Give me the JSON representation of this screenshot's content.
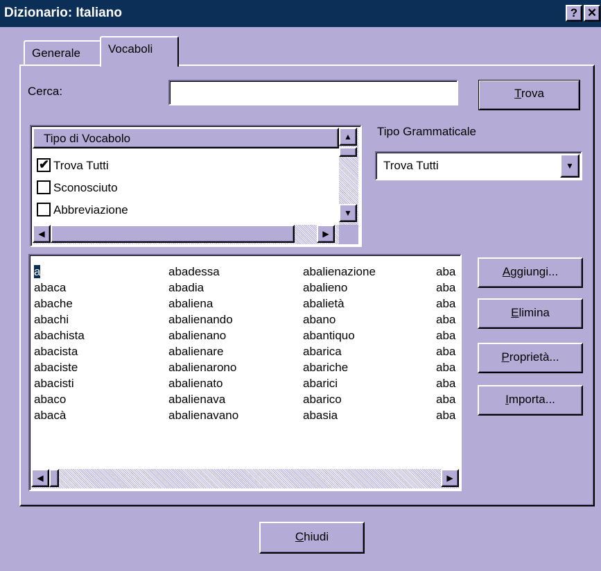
{
  "window": {
    "title": "Dizionario: Italiano",
    "help_label": "?",
    "close_label": "✕"
  },
  "tabs": [
    {
      "label": "Generale"
    },
    {
      "label": "Vocaboli"
    }
  ],
  "search": {
    "label": "Cerca:",
    "value": "",
    "button_label": "Trova",
    "button_mnemonic": "T",
    "button_rest": "rova"
  },
  "tipo_vocabolo": {
    "header": "Tipo di Vocabolo",
    "items": [
      {
        "label": "Trova Tutti",
        "checked": true
      },
      {
        "label": "Sconosciuto",
        "checked": false
      },
      {
        "label": "Abbreviazione",
        "checked": false
      }
    ]
  },
  "tipo_grammaticale": {
    "label": "Tipo Grammaticale",
    "selected": "Trova Tutti"
  },
  "words": {
    "columns": [
      [
        "a",
        "abaca",
        "abache",
        "abachi",
        "abachista",
        "abacista",
        "abaciste",
        "abacisti",
        "abaco",
        "abacà"
      ],
      [
        "abadessa",
        "abadia",
        "abaliena",
        "abalienando",
        "abalienano",
        "abalienare",
        "abalienarono",
        "abalienato",
        "abalienava",
        "abalienavano"
      ],
      [
        "abalienazione",
        "abalieno",
        "abalietà",
        "abano",
        "abantiquo",
        "abarica",
        "abariche",
        "abarici",
        "abarico",
        "abasia"
      ],
      [
        "aba",
        "aba",
        "aba",
        "aba",
        "aba",
        "aba",
        "aba",
        "aba",
        "aba",
        "aba"
      ]
    ],
    "selected": "a"
  },
  "buttons": {
    "aggiungi": {
      "mn": "A",
      "rest": "ggiungi..."
    },
    "elimina": {
      "mn": "E",
      "rest": "limina"
    },
    "proprieta": {
      "mn": "P",
      "rest": "roprietà..."
    },
    "importa": {
      "mn": "I",
      "rest": "mporta..."
    },
    "chiudi": {
      "mn": "C",
      "rest": "hiudi"
    }
  },
  "icons": {
    "scroll_up": "▲",
    "scroll_down": "▼",
    "scroll_left": "◀",
    "scroll_right": "▶",
    "dropdown": "▼",
    "check": "✔"
  }
}
